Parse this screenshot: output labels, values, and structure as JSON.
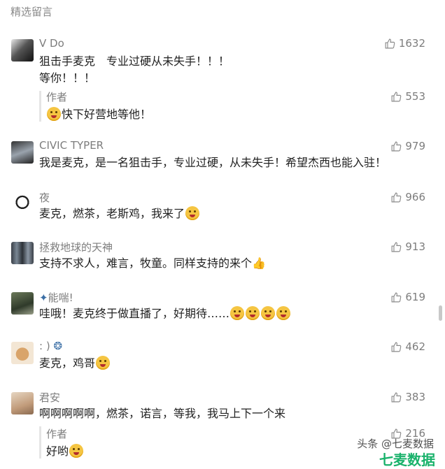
{
  "section_title": "精选留言",
  "comments": [
    {
      "nick": "V Do",
      "text_lines": [
        "狙击手麦克　专业过硬从未失手！！！",
        "  等你！！！"
      ],
      "likes": "1632",
      "reply": {
        "nick": "作者",
        "text": "快下好营地等他！",
        "likes": "553"
      }
    },
    {
      "nick": "CIVIC TYPER",
      "text_lines": [
        "我是麦克，是一名狙击手，专业过硬，从未失手！希望杰西也能入驻！"
      ],
      "likes": "979"
    },
    {
      "nick": "夜",
      "text_lines": [
        "麦克，燃茶，老斯鸡，我来了"
      ],
      "likes": "966"
    },
    {
      "nick": "拯救地球的天神",
      "text_lines": [
        "支持不求人，难言，牧童。同样支持的来个"
      ],
      "likes": "913"
    },
    {
      "nick": "能喘!",
      "text_lines": [
        "哇哦！麦克终于做直播了，好期待……"
      ],
      "likes": "619"
    },
    {
      "nick": ": )",
      "text_lines": [
        "麦克，鸡哥"
      ],
      "likes": "462"
    },
    {
      "nick": "君安",
      "text_lines": [
        "啊啊啊啊啊，燃茶，诺言，等我，我马上下一个来"
      ],
      "likes": "383",
      "reply": {
        "nick": "作者",
        "text": "好哟",
        "likes": "216"
      }
    }
  ],
  "watermark": "头条 @七麦数据",
  "watermark_brand": "七麦数据",
  "icons": {
    "like": "thumbs-up-icon"
  },
  "colors": {
    "meta": "#7d7d7d",
    "text": "#222222",
    "brand": "#19b26b"
  }
}
